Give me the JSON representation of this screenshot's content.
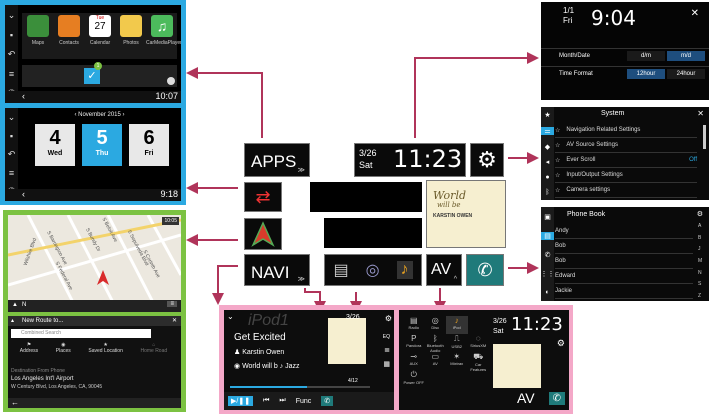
{
  "apps_screen": {
    "apps": [
      "Maps",
      "Contacts",
      "Calendar",
      "Photos",
      "CarMediaPlayer"
    ],
    "calendar_icon": {
      "day": "Tue",
      "date": "27"
    },
    "badge": "1",
    "clock": "10:07"
  },
  "calendar_screen": {
    "month": "November 2015",
    "days": [
      {
        "num": "4",
        "name": "Wed"
      },
      {
        "num": "5",
        "name": "Thu"
      },
      {
        "num": "6",
        "name": "Fri"
      }
    ],
    "clock": "9:18"
  },
  "map_screen": {
    "time": "10:05",
    "streets": [
      "Wilshire Blvd",
      "S Barrington Ave",
      "S Bundy Dr",
      "S Sepulveda Blvd",
      "S Federal Ave",
      "S Beloit Ave",
      "S Corinth Ave"
    ],
    "compass": "N"
  },
  "navi_menu": {
    "title": "New Route to...",
    "search_placeholder": "Combined Search",
    "options": [
      "Address",
      "Places",
      "Saved Location",
      "Home Road"
    ],
    "recent_header": "Destination From Phone",
    "recent_name": "Los Angeles Int'l Airport",
    "recent_address": "W Century Blvd, Los Angeles, CA, 90045"
  },
  "center": {
    "apps_label": "APPS",
    "navi_label": "NAVI",
    "av_label": "AV",
    "date": "3/26",
    "weekday": "Sat",
    "time": "11:23",
    "album_title": "World",
    "album_sub": "will be",
    "album_artist": "KARSTIN OWEN"
  },
  "clock_settings": {
    "date": "1/1",
    "weekday": "Fri",
    "time": "9:04",
    "rows": [
      {
        "label": "Month/Date",
        "options": [
          "d/m",
          "m/d"
        ]
      },
      {
        "label": "Time Format",
        "options": [
          "12hour",
          "24hour"
        ]
      }
    ]
  },
  "system_settings": {
    "title": "System",
    "items": [
      "Navigation Related Settings",
      "AV Source Settings",
      "Ever Scroll",
      "Input/Output Settings",
      "Camera settings"
    ],
    "ever_scroll_value": "Off"
  },
  "phone_book": {
    "title": "Phone Book",
    "contacts": [
      "Andy",
      "Bob",
      "Bob",
      "Edward",
      "Jackie"
    ],
    "alpha": [
      "A",
      "B",
      "J",
      "M",
      "N",
      "S",
      "Z"
    ]
  },
  "ipod_screen": {
    "title": "iPod1",
    "song": "Get Excited",
    "artist": "Karstin Owen",
    "album": "World will b",
    "genre": "Jazz",
    "date": "3/26",
    "time": "11:23",
    "track": "4/12",
    "func": "Func",
    "eq": "EQ"
  },
  "av_source": {
    "sources": [
      "Radio",
      "Disc",
      "iPod",
      "Pandora",
      "Bluetooth Audio",
      "USB2",
      "SiriusXM",
      "AUX",
      "AV",
      "Mixtrax",
      "Car Features",
      "Car Features",
      "Camera View",
      "Source OFF",
      "Power OFF"
    ],
    "date": "3/26",
    "weekday": "Sat",
    "time": "11:23",
    "av_label": "AV"
  },
  "colors": {
    "accent": "#2ba9e1",
    "green": "#7cc242",
    "pink": "#f4a8c8",
    "arrow": "#b0345a"
  }
}
